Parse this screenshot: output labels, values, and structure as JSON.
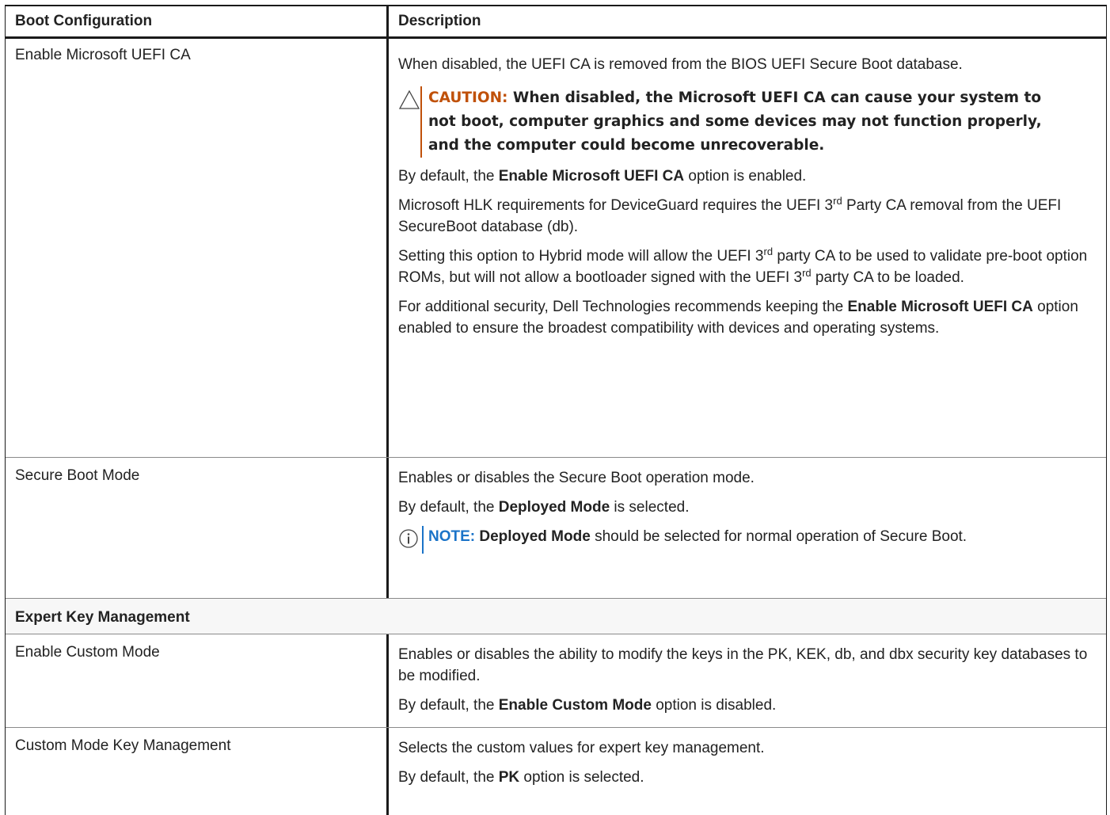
{
  "table": {
    "headers": {
      "col1": "Boot Configuration",
      "col2": "Description"
    },
    "row_ms_ca": {
      "name": "Enable Microsoft UEFI CA",
      "p1": "When disabled, the UEFI CA is removed from the BIOS UEFI Secure Boot database.",
      "caution_label": "CAUTION:",
      "caution_text": " When disabled, the Microsoft UEFI CA can cause your system to not boot, computer graphics and some devices may not function properly, and the computer could become unrecoverable.",
      "p2_pre": "By default, the ",
      "p2_bold": "Enable Microsoft UEFI CA",
      "p2_post": " option is enabled.",
      "p3_a": "Microsoft HLK requirements for DeviceGuard requires the UEFI 3",
      "p3_sup": "rd",
      "p3_b": " Party CA removal from the UEFI SecureBoot database (db).",
      "p4_a": "Setting this option to Hybrid mode will allow the UEFI 3",
      "p4_sup1": "rd",
      "p4_b": " party CA to be used to validate pre-boot option ROMs, but will not allow a bootloader signed with the UEFI 3",
      "p4_sup2": "rd",
      "p4_c": " party CA to be loaded.",
      "p5_pre": "For additional security, Dell Technologies recommends keeping the ",
      "p5_bold": "Enable Microsoft UEFI CA",
      "p5_post": " option enabled to ensure the broadest compatibility with devices and operating systems."
    },
    "row_secure_boot": {
      "name": "Secure Boot Mode",
      "p1": "Enables or disables the Secure Boot operation mode.",
      "p2_pre": "By default, the ",
      "p2_bold": "Deployed Mode",
      "p2_post": " is selected.",
      "note_label": "NOTE:",
      "note_bold": " Deployed Mode",
      "note_text": " should be selected for normal operation of Secure Boot."
    },
    "section_title": "Expert Key Management",
    "row_custom_mode": {
      "name": "Enable Custom Mode",
      "p1": "Enables or disables the ability to modify the keys in the PK, KEK, db, and dbx security key databases to be modified.",
      "p2_pre": "By default, the ",
      "p2_bold": "Enable Custom Mode",
      "p2_post": " option is disabled."
    },
    "row_key_mgmt": {
      "name": "Custom Mode Key Management",
      "p1": "Selects the custom values for expert key management.",
      "p2_pre": "By default, the ",
      "p2_bold": "PK",
      "p2_post": " option is selected."
    }
  },
  "icons": {
    "caution": "warning-triangle-icon",
    "note": "info-circle-icon"
  },
  "colors": {
    "caution": "#c0510a",
    "note": "#1a73c8",
    "border": "#1a1a1a"
  }
}
